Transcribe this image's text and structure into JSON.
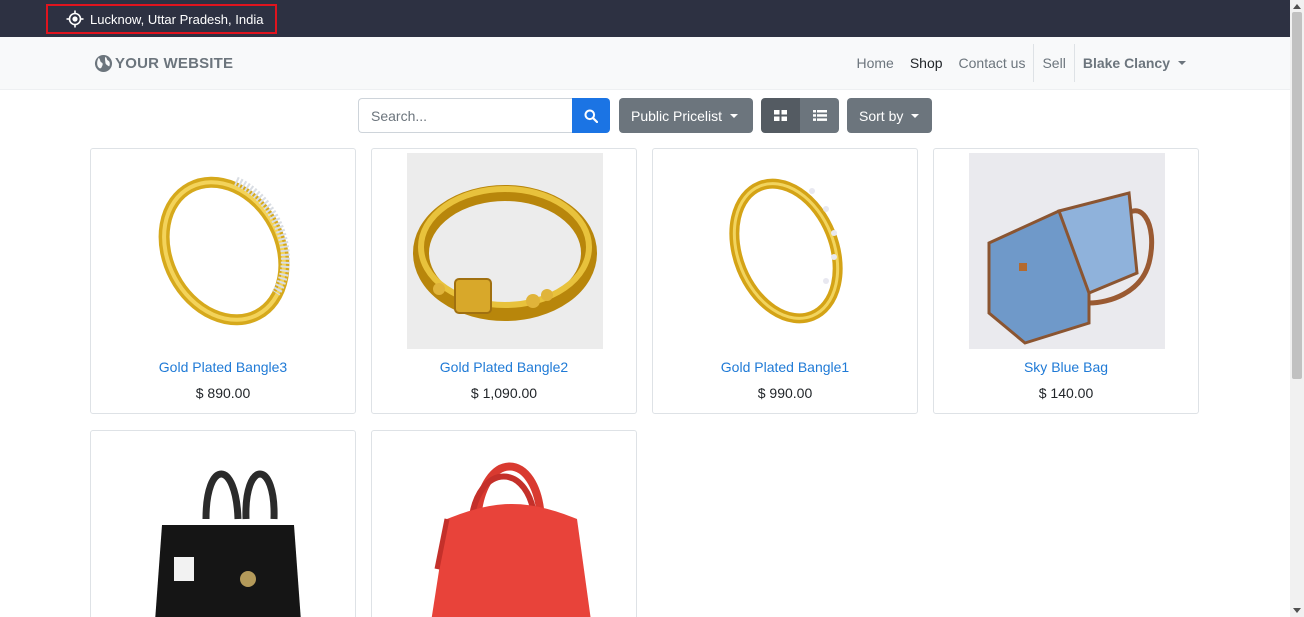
{
  "topbar": {
    "location": "Lucknow, Uttar Pradesh, India",
    "location_icon": "location-target-icon"
  },
  "navbar": {
    "brand": "YOUR WEBSITE",
    "items": [
      {
        "label": "Home",
        "active": false
      },
      {
        "label": "Shop",
        "active": true
      },
      {
        "label": "Contact us",
        "active": false
      }
    ],
    "sell": "Sell",
    "user": "Blake Clancy"
  },
  "toolbar": {
    "search_placeholder": "Search...",
    "pricelist": "Public Pricelist",
    "sort_by": "Sort by",
    "view_mode": "grid"
  },
  "products": [
    {
      "name": "Gold Plated Bangle3",
      "price": "$ 890.00"
    },
    {
      "name": "Gold Plated Bangle2",
      "price": "$ 1,090.00"
    },
    {
      "name": "Gold Plated Bangle1",
      "price": "$ 990.00"
    },
    {
      "name": "Sky Blue Bag",
      "price": "$ 140.00"
    },
    {
      "name": "",
      "price": ""
    },
    {
      "name": "",
      "price": ""
    }
  ],
  "colors": {
    "accent": "#1b74e4",
    "link": "#1f7ad6",
    "topbar": "#2d3142",
    "highlight": "#e0141e"
  }
}
